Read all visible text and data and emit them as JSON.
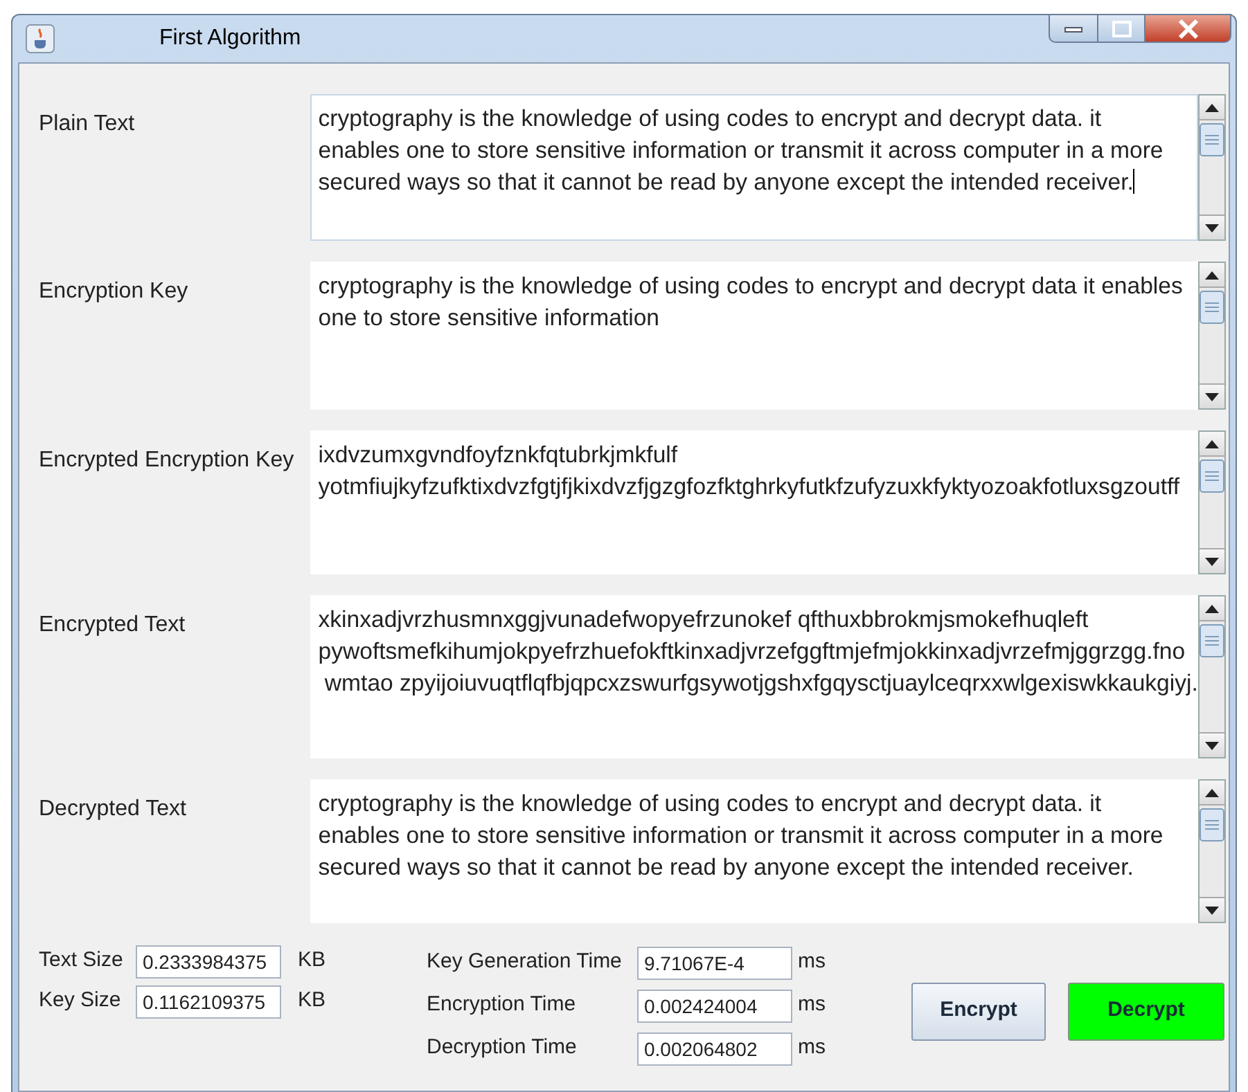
{
  "window": {
    "title": "First Algorithm"
  },
  "fields": [
    {
      "label": "Plain Text",
      "lines": [
        "cryptography is the knowledge of using codes to encrypt and decrypt data. it",
        "enables one to store sensitive information or transmit it across computer in a more",
        "secured ways so that it cannot be read by anyone except the intended receiver."
      ],
      "focused": true
    },
    {
      "label": "Encryption Key",
      "lines": [
        "cryptography is the knowledge of using codes to encrypt and decrypt data it enables",
        "one to store sensitive information"
      ],
      "focused": false
    },
    {
      "label": "Encrypted Encryption Key",
      "lines": [
        "ixdvzumxgvndfoyfznkfqtubrkjmkfulf",
        "yotmfiujkyfzufktixdvzfgtjfjkixdvzfjgzgfozfktghrkyfutkfzufyzuxkfyktyozoakfotluxsgzoutff"
      ],
      "focused": false
    },
    {
      "label": "Encrypted Text",
      "lines": [
        "xkinxadjvrzhusmnxggjvunadefwopyefrzunokef qfthuxbbrokmjsmokefhuqleft",
        "pywoftsmefkihumjokpyefrzhuefokftkinxadjvrzefggftmjefmjokkinxadjvrzefmjggrzgg.fno",
        " wmtao zpyijoiuvuqtflqfbjqpcxzswurfgsywotjgshxfgqysctjuaylceqrxxwlgexiswkkaukgiyj."
      ],
      "focused": false
    },
    {
      "label": "Decrypted Text",
      "lines": [
        "cryptography is the knowledge of using codes to encrypt and decrypt data. it",
        "enables one to store sensitive information or transmit it across computer in a more",
        "secured ways so that it cannot be read by anyone except the intended receiver."
      ],
      "focused": false
    }
  ],
  "sizes": [
    {
      "label": "Text Size",
      "value": "0.2333984375",
      "unit": "KB"
    },
    {
      "label": "Key Size",
      "value": "0.1162109375",
      "unit": "KB"
    }
  ],
  "times": [
    {
      "label": "Key Generation Time",
      "value": "9.71067E-4",
      "unit": "ms"
    },
    {
      "label": "Encryption Time",
      "value": "0.002424004",
      "unit": "ms"
    },
    {
      "label": "Decryption Time",
      "value": "0.002064802",
      "unit": "ms"
    }
  ],
  "buttons": [
    {
      "label": "Encrypt",
      "kind": "plain"
    },
    {
      "label": "Decrypt",
      "kind": "green"
    }
  ]
}
